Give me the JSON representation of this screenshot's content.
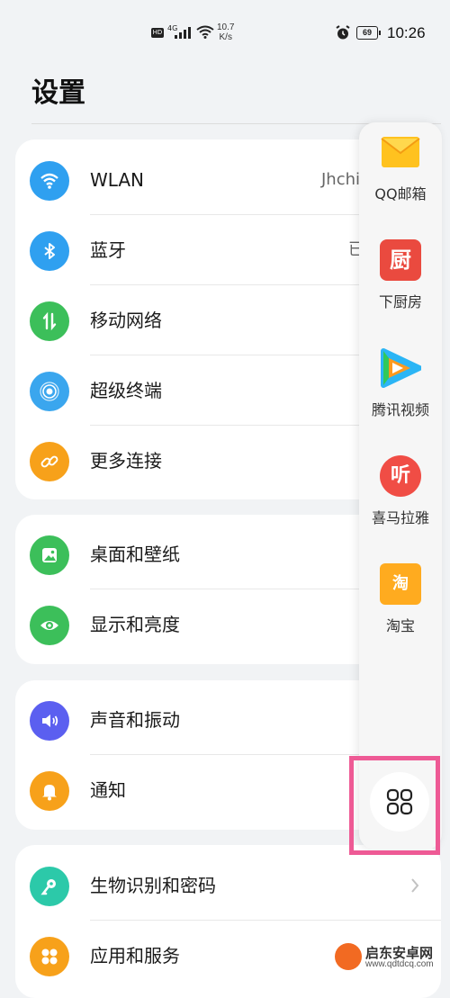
{
  "status_bar": {
    "hd": "HD",
    "network": "4G",
    "speed_value": "10.7",
    "speed_unit": "K/s",
    "battery": "69",
    "time": "10:26"
  },
  "page_title": "设置",
  "group1": [
    {
      "label": "WLAN",
      "value": "Jhchi",
      "icon": "wifi-icon",
      "color": "#2fa0f0"
    },
    {
      "label": "蓝牙",
      "value": "已",
      "icon": "bluetooth-icon",
      "color": "#2fa0f0"
    },
    {
      "label": "移动网络",
      "icon": "mobile-data-icon",
      "color": "#3cbf5a"
    },
    {
      "label": "超级终端",
      "icon": "super-device-icon",
      "color": "#3aa6ee"
    },
    {
      "label": "更多连接",
      "icon": "link-icon",
      "color": "#f7a11a"
    }
  ],
  "group2": [
    {
      "label": "桌面和壁纸",
      "icon": "wallpaper-icon",
      "color": "#3cbf5a"
    },
    {
      "label": "显示和亮度",
      "icon": "eye-icon",
      "color": "#3cbf5a"
    }
  ],
  "group3": [
    {
      "label": "声音和振动",
      "icon": "speaker-icon",
      "color": "#5b5ff0"
    },
    {
      "label": "通知",
      "icon": "bell-icon",
      "color": "#f7a11a"
    }
  ],
  "group4": [
    {
      "label": "生物识别和密码",
      "icon": "key-icon",
      "color": "#2cc9a9"
    },
    {
      "label": "应用和服务",
      "icon": "apps-icon",
      "color": "#f7a11a"
    }
  ],
  "dock": {
    "apps": [
      {
        "name": "QQ邮箱",
        "icon": "qq-mail-icon"
      },
      {
        "name": "下厨房",
        "icon": "xiachufang-icon",
        "glyph": "厨"
      },
      {
        "name": "腾讯视频",
        "icon": "tencent-video-icon"
      },
      {
        "name": "喜马拉雅",
        "icon": "ximalaya-icon",
        "glyph": "听"
      },
      {
        "name": "淘宝",
        "icon": "taobao-icon",
        "glyph": "淘"
      }
    ]
  },
  "watermark": {
    "name": "启东安卓网",
    "url": "www.qdtdcq.com"
  }
}
